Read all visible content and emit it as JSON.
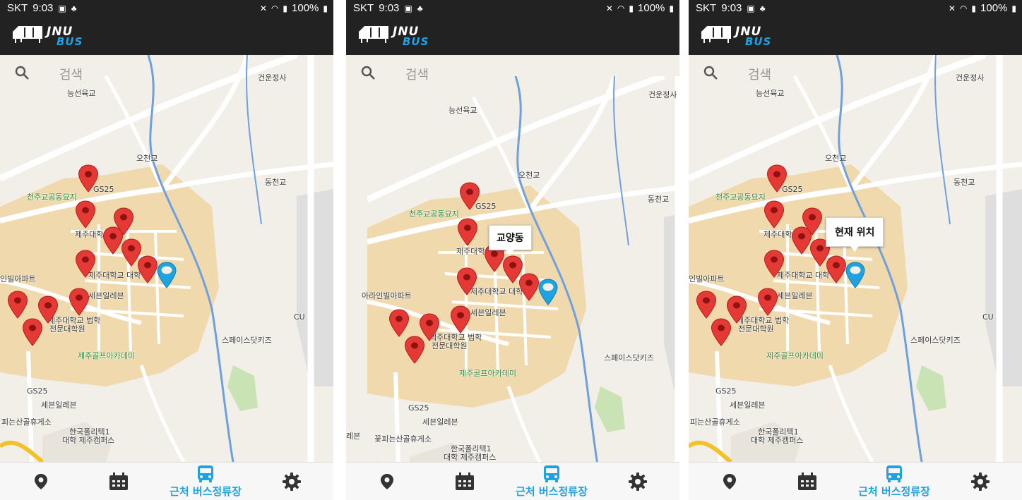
{
  "screens": [
    {
      "status": {
        "carrier": "SKT",
        "time": "9:03",
        "battery": "100%"
      },
      "app": {
        "logo_top": "JNU",
        "logo_bottom": "BUS"
      },
      "search": {
        "placeholder": "검색"
      },
      "map_labels": [
        "건운정사",
        "능선육교",
        "오천교",
        "동천교",
        "GS25",
        "천주교공동묘지",
        "제주대학",
        "제주대학교 대학",
        "인빌아파트",
        "세븐일레븐",
        "제주대학교 법학",
        "전문대학원",
        "CU",
        "스페이스닷키즈",
        "제주골프아카데미",
        "GS25",
        "세븐일레븐",
        "피는산골휴게소",
        "한국폴리텍1",
        "대학 제주캠퍼스"
      ],
      "callout": "",
      "nav": {
        "active_label": "근처 버스정류장"
      }
    },
    {
      "status": {
        "carrier": "SKT",
        "time": "9:03",
        "battery": "100%"
      },
      "app": {
        "logo_top": "JNU",
        "logo_bottom": "BUS"
      },
      "search": {
        "placeholder": "검색"
      },
      "map_labels": [
        "건운정사",
        "능선육교",
        "오천교",
        "동천교",
        "GS25",
        "천주교공동묘지",
        "제주대학",
        "제주대학교 대학",
        "아라인빌아파트",
        "세븐일레븐",
        "제주대학교 법학",
        "전문대학원",
        "스페이스닷키즈",
        "제주골프아카데미",
        "GS25",
        "세븐일레븐",
        "꽃피는산골휴게소",
        "한국폴리텍1",
        "대학 제주캠퍼스",
        "레븐"
      ],
      "callout": "교양동",
      "nav": {
        "active_label": "근처 버스정류장"
      }
    },
    {
      "status": {
        "carrier": "SKT",
        "time": "9:03",
        "battery": "100%"
      },
      "app": {
        "logo_top": "JNU",
        "logo_bottom": "BUS"
      },
      "search": {
        "placeholder": "검색"
      },
      "map_labels": [
        "건운정사",
        "능선육교",
        "오천교",
        "동천교",
        "GS25",
        "천주교공동묘지",
        "제주대학",
        "제주대학교 대학",
        "인빌아파트",
        "세븐일레븐",
        "제주대학교 법학",
        "전문대학원",
        "CU",
        "스페이스닷키즈",
        "제주골프아카데미",
        "GS25",
        "세븐일레븐",
        "피는산골휴게소",
        "한국폴리텍1",
        "대학 제주캠퍼스"
      ],
      "callout": "현재 위치",
      "nav": {
        "active_label": "근처 버스정류장"
      }
    }
  ],
  "colors": {
    "accent": "#1fa3e0",
    "bar": "#222222",
    "pin_red": "#e53935",
    "pin_blue": "#1fa3e0",
    "campus": "#efd9ad"
  },
  "icons": [
    "search-icon",
    "map-pin-icon",
    "calendar-icon",
    "bus-icon",
    "gear-icon",
    "bus-stop-pin-icon",
    "current-location-pin-icon"
  ]
}
